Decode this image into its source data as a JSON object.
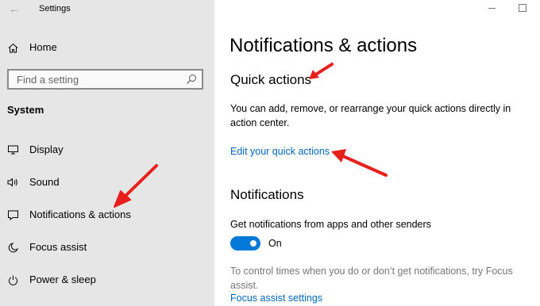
{
  "window": {
    "title": "Settings",
    "back_icon": "back-arrow-icon",
    "minimize_icon": "minimize-icon",
    "maximize_icon": "maximize-icon"
  },
  "sidebar": {
    "home_label": "Home",
    "search_placeholder": "Find a setting",
    "section_label": "System",
    "items": [
      {
        "label": "Display",
        "icon": "display-icon"
      },
      {
        "label": "Sound",
        "icon": "sound-icon"
      },
      {
        "label": "Notifications & actions",
        "icon": "notifications-icon"
      },
      {
        "label": "Focus assist",
        "icon": "focus-assist-icon"
      },
      {
        "label": "Power & sleep",
        "icon": "power-icon"
      }
    ]
  },
  "main": {
    "title": "Notifications & actions",
    "quick_actions": {
      "heading": "Quick actions",
      "description": "You can add, remove, or rearrange your quick actions directly in action center.",
      "link": "Edit your quick actions"
    },
    "notifications": {
      "heading": "Notifications",
      "setting_label": "Get notifications from apps and other senders",
      "toggle_state": "On",
      "focus_text": "To control times when you do or don’t get notifications, try Focus assist.",
      "focus_link": "Focus assist settings"
    }
  },
  "colors": {
    "sidebar_bg": "#e6e6e6",
    "accent": "#0078d7",
    "link": "#0067c0",
    "annotation_arrow": "#e8201c"
  }
}
